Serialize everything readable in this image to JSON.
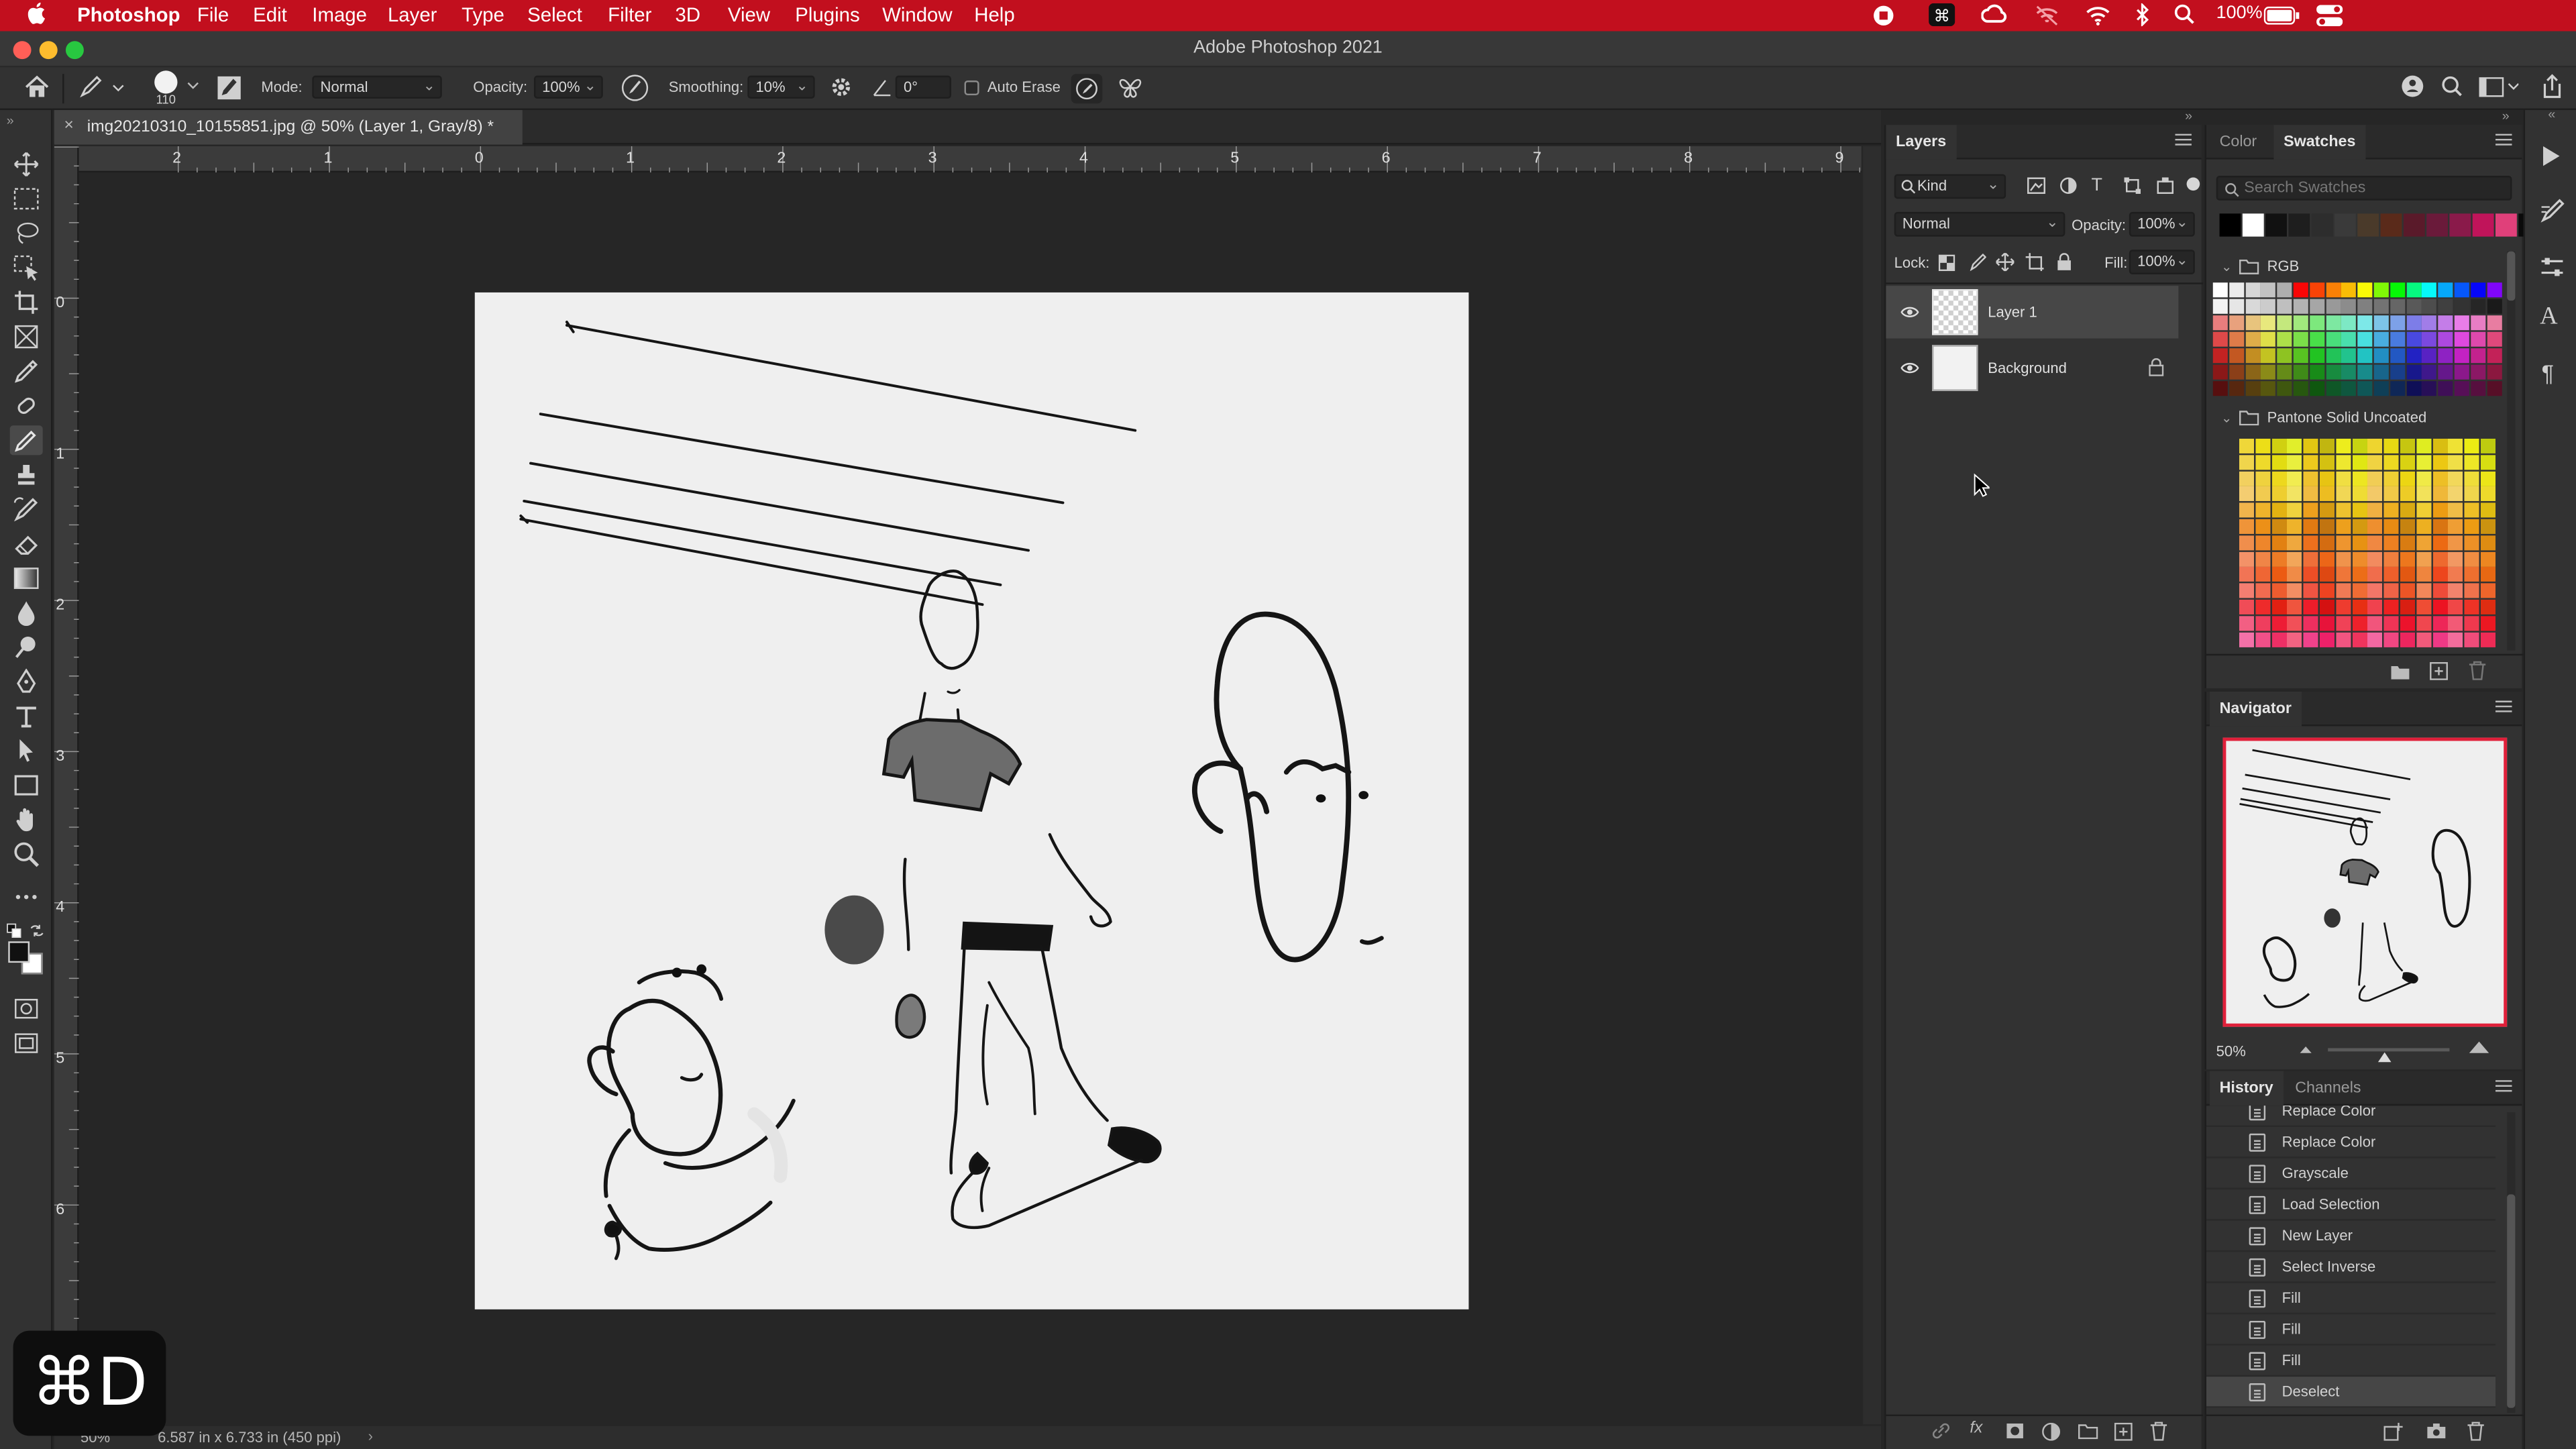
{
  "menubar": {
    "apple": "",
    "app_name": "Photoshop",
    "items": [
      "File",
      "Edit",
      "Image",
      "Layer",
      "Type",
      "Select",
      "Filter",
      "3D",
      "View",
      "Plugins",
      "Window",
      "Help"
    ],
    "battery": "100%"
  },
  "window": {
    "title": "Adobe Photoshop 2021"
  },
  "options": {
    "brush_size": "110",
    "mode_label": "Mode:",
    "mode_value": "Normal",
    "opacity_label": "Opacity:",
    "opacity_value": "100%",
    "smoothing_label": "Smoothing:",
    "smoothing_value": "10%",
    "angle_value": "0°",
    "auto_erase_label": "Auto Erase"
  },
  "document": {
    "tab_title": "img20210310_10155851.jpg @ 50% (Layer 1, Gray/8) *",
    "ruler_h": [
      "2",
      "1",
      "0",
      "1",
      "2",
      "3",
      "4",
      "5",
      "6",
      "7",
      "8",
      "9"
    ],
    "ruler_v": [
      "0",
      "1",
      "2",
      "3",
      "4",
      "5",
      "6"
    ],
    "zoom": "50%",
    "doc_info": "6.587 in x 6.733 in (450 ppi)"
  },
  "layers_panel": {
    "tab": "Layers",
    "kind_label": "Kind",
    "blend_mode": "Normal",
    "opacity_label": "Opacity:",
    "opacity_value": "100%",
    "lock_label": "Lock:",
    "fill_label": "Fill:",
    "fill_value": "100%",
    "layers": [
      {
        "name": "Layer 1",
        "selected": true
      },
      {
        "name": "Background",
        "locked": true
      }
    ]
  },
  "swatches_panel": {
    "tabs": [
      "Color",
      "Swatches"
    ],
    "search_placeholder": "Search Swatches",
    "group_rgb": "RGB",
    "group_pantone": "Pantone Solid Uncoated"
  },
  "navigator_panel": {
    "tab": "Navigator",
    "zoom": "50%"
  },
  "history_panel": {
    "tabs": [
      "History",
      "Channels"
    ],
    "items": [
      "Replace Color",
      "Replace Color",
      "Grayscale",
      "Load Selection",
      "New Layer",
      "Select Inverse",
      "Fill",
      "Fill",
      "Fill",
      "Deselect"
    ]
  },
  "shortcut_overlay": {
    "keys": "⌘D"
  },
  "colors": {
    "menubar": "#c20f1e",
    "panel": "#323232",
    "canvas_bg": "#262626",
    "paper": "#efefef",
    "ink": "#111111"
  }
}
